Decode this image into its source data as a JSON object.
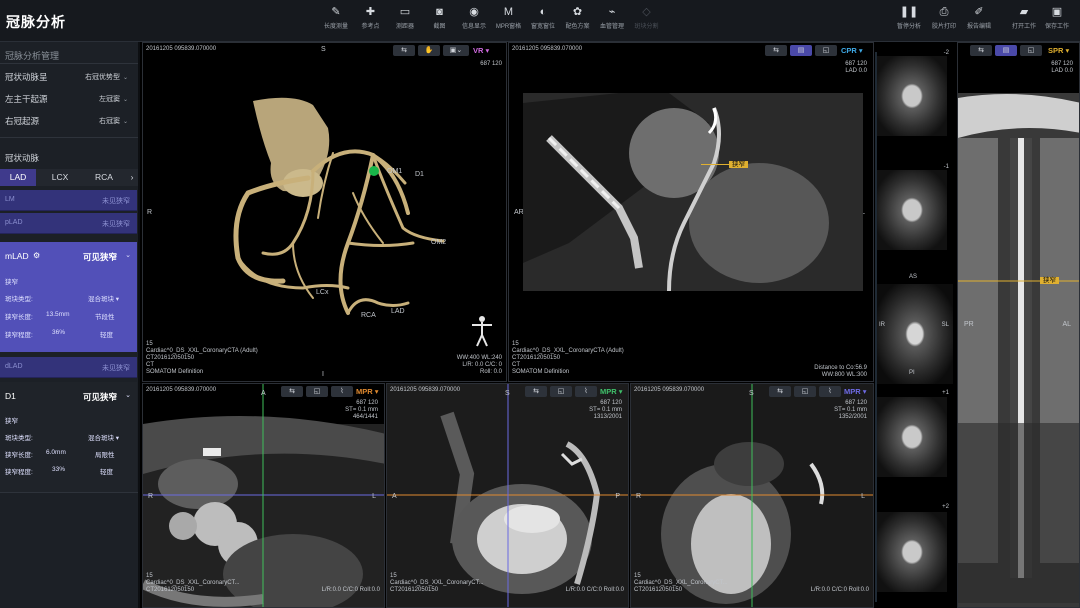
{
  "app": {
    "title": "冠脉分析"
  },
  "toolbar": [
    {
      "label": "长度测量",
      "icon": "ruler-icon",
      "glyph": "✎",
      "enabled": true
    },
    {
      "label": "参考点",
      "icon": "crosshair-icon",
      "glyph": "✚",
      "enabled": true
    },
    {
      "label": "测距器",
      "icon": "caliper-icon",
      "glyph": "▭",
      "enabled": true
    },
    {
      "label": "截图",
      "icon": "camera-icon",
      "glyph": "◙",
      "enabled": true
    },
    {
      "label": "信息显示",
      "icon": "eye-icon",
      "glyph": "◉",
      "enabled": true
    },
    {
      "label": "MPR窗格",
      "icon": "mpr-icon",
      "glyph": "M",
      "enabled": true
    },
    {
      "label": "窗宽窗位",
      "icon": "contrast-icon",
      "glyph": "◐",
      "enabled": true
    },
    {
      "label": "配色方案",
      "icon": "palette-icon",
      "glyph": "✿",
      "enabled": true
    },
    {
      "label": "血管管理",
      "icon": "vessel-icon",
      "glyph": "⌁",
      "enabled": true
    },
    {
      "label": "斑块分割",
      "icon": "segment-icon",
      "glyph": "◇",
      "enabled": false
    }
  ],
  "actions": [
    {
      "label": "暂停分析",
      "icon": "pause-icon",
      "glyph": "❚❚"
    },
    {
      "label": "胶片打印",
      "icon": "print-icon",
      "glyph": "⎙"
    },
    {
      "label": "报告编辑",
      "icon": "report-edit-icon",
      "glyph": "✐"
    },
    {
      "label": "打开工作",
      "icon": "folder-icon",
      "glyph": "▰"
    },
    {
      "label": "保存工作",
      "icon": "save-icon",
      "glyph": "▣"
    }
  ],
  "sidebar": {
    "manage_title": "冠脉分析管理",
    "rows": [
      {
        "label": "冠状动脉呈",
        "value": "右冠优势型"
      },
      {
        "label": "左主干起源",
        "value": "左冠窦"
      },
      {
        "label": "右冠起源",
        "value": "右冠窦"
      }
    ],
    "artery_title": "冠状动脉",
    "tabs": [
      "LAD",
      "LCX",
      "RCA"
    ],
    "tab_more": "›",
    "segments": [
      {
        "name": "LM",
        "status": "未见狭窄"
      },
      {
        "name": "pLAD",
        "status": "未见狭窄"
      }
    ],
    "mlad": {
      "name": "mLAD",
      "status": "可见狭窄",
      "sub": "狭窄",
      "plaque_label": "斑块类型:",
      "plaque_value": "混合斑块",
      "length_label": "狭窄长度:",
      "length_value": "13.5mm",
      "length_type": "节段性",
      "degree_label": "狭窄程度:",
      "degree_value": "36%",
      "degree_text": "轻度"
    },
    "dlad": {
      "name": "dLAD",
      "status": "未见狭窄"
    },
    "d1": {
      "name": "D1",
      "status": "可见狭窄",
      "sub": "狭窄",
      "plaque_label": "斑块类型:",
      "plaque_value": "混合斑块",
      "length_label": "狭窄长度:",
      "length_value": "6.0mm",
      "length_type": "局限性",
      "degree_label": "狭窄程度:",
      "degree_value": "33%",
      "degree_text": "轻度"
    }
  },
  "viewports": {
    "vr": {
      "mode": "VR",
      "mode_color": "#d06be0",
      "timestamp": "20161205 095839.070000",
      "wl_top": "687 120",
      "labels": [
        "OM1",
        "D1",
        "OM2",
        "LCx",
        "RCA",
        "LAD"
      ],
      "orient": {
        "top": "S",
        "left": "R",
        "bottom": "I"
      },
      "info": [
        "15",
        "Cardiac^0_DS_XXL_CoronaryCTA (Adult)",
        "CT201612050150",
        "CT",
        "SOMATOM Definition"
      ],
      "br": [
        "WW:400 WL:240",
        "L/R: 0.0   C/C: 0",
        "Roll: 0.0"
      ]
    },
    "cpr": {
      "mode": "CPR",
      "mode_color": "#3fa9e6",
      "timestamp": "20161205 095839.070000",
      "tr": [
        "687 120",
        "LAD 0.0"
      ],
      "orient": {
        "left": "AR",
        "right": "PL"
      },
      "stenosis": "狭窄",
      "info": [
        "15",
        "Cardiac^0_DS_XXL_CoronaryCTA (Adult)",
        "CT201612050150",
        "CT",
        "SOMATOM Definition"
      ],
      "br": [
        "Distance to Co:56.9",
        "WW:800 WL:300"
      ]
    },
    "mpr1": {
      "mode": "MPR",
      "mode_color": "#e08a30",
      "timestamp": "20161205 095839.070000",
      "tr": [
        "687 120",
        "ST=  0.1  mm",
        "464/1441"
      ],
      "orient": {
        "top": "A",
        "left": "R",
        "right": "L"
      },
      "info": [
        "15",
        "Cardiac^0_DS_XXL_CoronaryCT...",
        "CT201612050150"
      ],
      "br": [
        "L/R:0.0  C/C:0  Roll:0.0"
      ]
    },
    "mpr2": {
      "mode": "MPR",
      "mode_color": "#3fc06a",
      "timestamp": "20161205 095839.070000",
      "tr": [
        "687 120",
        "ST=  0.1  mm",
        "1313/2001"
      ],
      "orient": {
        "top": "S",
        "left": "A",
        "right": "P"
      },
      "info": [
        "15",
        "Cardiac^0_DS_XXL_CoronaryCT...",
        "CT201612050150"
      ],
      "br": [
        "L/R:0.0  C/C:0  Roll:0.0"
      ]
    },
    "mpr3": {
      "mode": "MPR",
      "mode_color": "#6f6be6",
      "timestamp": "20161205 095839.070000",
      "tr": [
        "687 120",
        "ST=  0.1  mm",
        "1352/2001"
      ],
      "orient": {
        "top": "S",
        "left": "R",
        "right": "L"
      },
      "info": [
        "15",
        "Cardiac^0_DS_XXL_CoronaryCT...",
        "CT201612050150"
      ],
      "br": [
        "L/R:0.0  C/C:0  Roll:0.0"
      ]
    },
    "strip": {
      "ticks": [
        "-2",
        "-1",
        "AS",
        "IR",
        "SL",
        "PI",
        "+1",
        "+2"
      ]
    },
    "spr": {
      "mode": "SPR",
      "mode_color": "#e0b030",
      "tr": [
        "687 120",
        "LAD 0.0"
      ],
      "orient": {
        "left": "PR",
        "right": "AL"
      },
      "stenosis": "狭窄"
    }
  }
}
